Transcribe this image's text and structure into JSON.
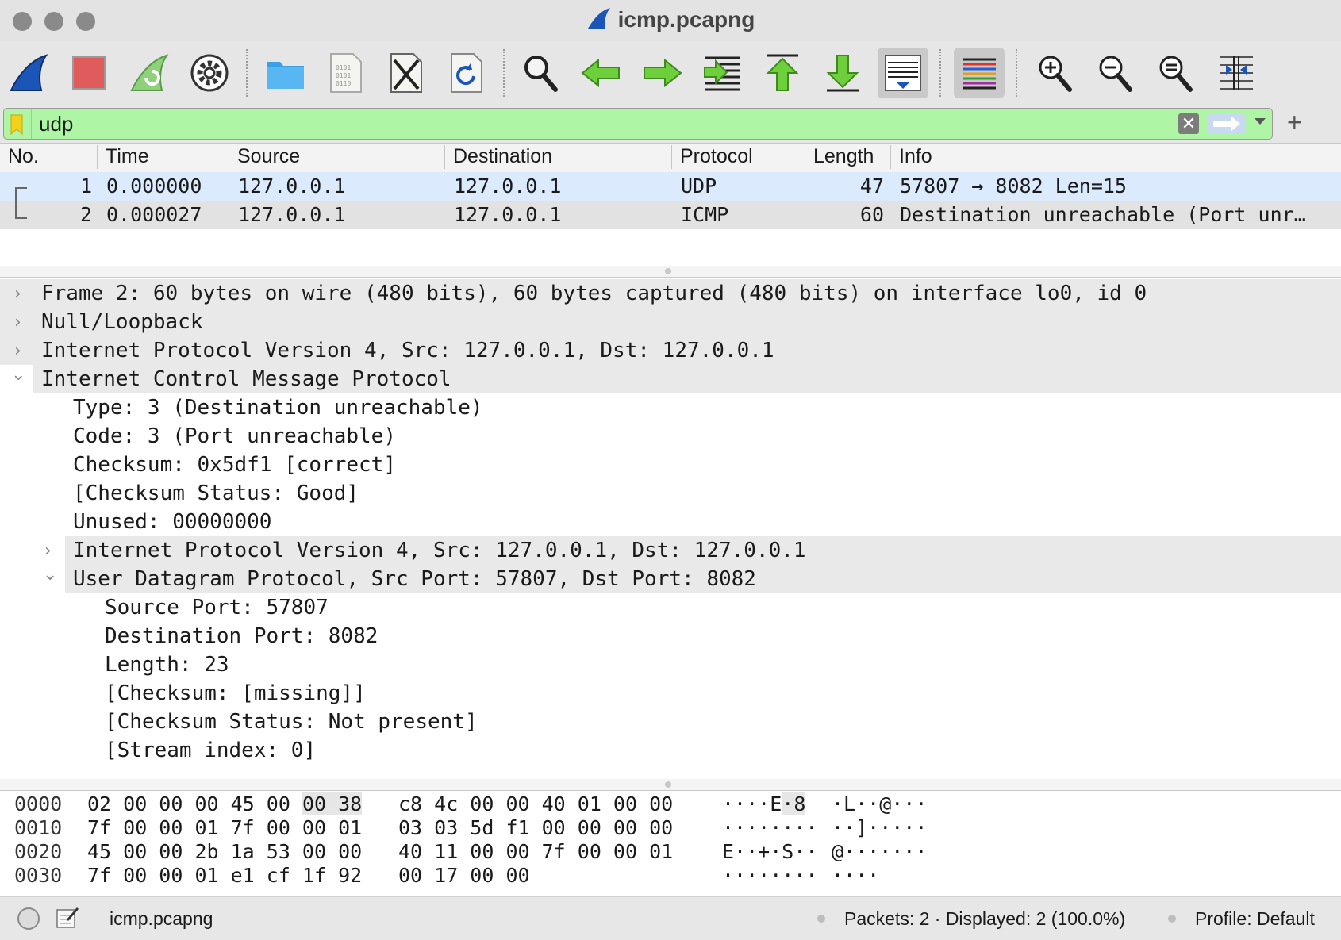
{
  "window": {
    "title": "icmp.pcapng"
  },
  "toolbar": {
    "buttons": [
      {
        "name": "start-capture-icon"
      },
      {
        "name": "stop-capture-icon"
      },
      {
        "name": "restart-capture-icon"
      },
      {
        "name": "capture-options-icon"
      },
      {
        "name": "open-file-icon"
      },
      {
        "name": "save-file-icon"
      },
      {
        "name": "close-file-icon"
      },
      {
        "name": "reload-file-icon"
      },
      {
        "name": "find-packet-icon"
      },
      {
        "name": "go-back-icon"
      },
      {
        "name": "go-forward-icon"
      },
      {
        "name": "go-to-packet-icon"
      },
      {
        "name": "go-first-packet-icon"
      },
      {
        "name": "go-last-packet-icon"
      },
      {
        "name": "autoscroll-icon"
      },
      {
        "name": "colorize-icon"
      },
      {
        "name": "zoom-in-icon"
      },
      {
        "name": "zoom-out-icon"
      },
      {
        "name": "zoom-normal-icon"
      },
      {
        "name": "resize-columns-icon"
      }
    ]
  },
  "filter": {
    "value": "udp",
    "clear_symbol": "✕",
    "plus_symbol": "+"
  },
  "packet_list": {
    "columns": [
      "No.",
      "Time",
      "Source",
      "Destination",
      "Protocol",
      "Length",
      "Info"
    ],
    "rows": [
      {
        "no": "1",
        "time": "0.000000",
        "source": "127.0.0.1",
        "destination": "127.0.0.1",
        "protocol": "UDP",
        "length": "47",
        "info": "57807 → 8082 Len=15"
      },
      {
        "no": "2",
        "time": "0.000027",
        "source": "127.0.0.1",
        "destination": "127.0.0.1",
        "protocol": "ICMP",
        "length": "60",
        "info": "Destination unreachable (Port unr…"
      }
    ]
  },
  "details": {
    "chevron_collapsed": "›",
    "chevron_expanded": "⌄",
    "rows": [
      {
        "text": "Frame 2: 60 bytes on wire (480 bits), 60 bytes captured (480 bits) on interface lo0, id 0",
        "expandable": "collapsed"
      },
      {
        "text": "Null/Loopback",
        "expandable": "collapsed"
      },
      {
        "text": "Internet Protocol Version 4, Src: 127.0.0.1, Dst: 127.0.0.1",
        "expandable": "collapsed"
      },
      {
        "text": "Internet Control Message Protocol",
        "expandable": "expanded"
      },
      {
        "text": "Type: 3 (Destination unreachable)",
        "expandable": "none"
      },
      {
        "text": "Code: 3 (Port unreachable)",
        "expandable": "none"
      },
      {
        "text": "Checksum: 0x5df1 [correct]",
        "expandable": "none"
      },
      {
        "text": "[Checksum Status: Good]",
        "expandable": "none"
      },
      {
        "text": "Unused: 00000000",
        "expandable": "none"
      },
      {
        "text": "Internet Protocol Version 4, Src: 127.0.0.1, Dst: 127.0.0.1",
        "expandable": "collapsed"
      },
      {
        "text": "User Datagram Protocol, Src Port: 57807, Dst Port: 8082",
        "expandable": "expanded"
      },
      {
        "text": "Source Port: 57807",
        "expandable": "none"
      },
      {
        "text": "Destination Port: 8082",
        "expandable": "none"
      },
      {
        "text": "Length: 23",
        "expandable": "none"
      },
      {
        "text": "[Checksum: [missing]]",
        "expandable": "none"
      },
      {
        "text": "[Checksum Status: Not present]",
        "expandable": "none"
      },
      {
        "text": "[Stream index: 0]",
        "expandable": "none"
      }
    ]
  },
  "bytes": {
    "rows": [
      {
        "offset": "0000",
        "hex1": "02 00 00 00 45 00",
        "hex1_hl": "00 38",
        "hex2": "c8 4c 00 00 40 01 00 00",
        "ascii1": "····E",
        "ascii1_hl": "·8",
        "ascii2": "·L··@···"
      },
      {
        "offset": "0010",
        "hex1": "7f 00 00 01 7f 00 00 01",
        "hex1_hl": "",
        "hex2": "03 03 5d f1 00 00 00 00",
        "ascii1": "········",
        "ascii1_hl": "",
        "ascii2": "··]·····"
      },
      {
        "offset": "0020",
        "hex1": "45 00 00 2b 1a 53 00 00",
        "hex1_hl": "",
        "hex2": "40 11 00 00 7f 00 00 01",
        "ascii1": "E··+·S··",
        "ascii1_hl": "",
        "ascii2": "@·······"
      },
      {
        "offset": "0030",
        "hex1": "7f 00 00 01 e1 cf 1f 92",
        "hex1_hl": "",
        "hex2": "00 17 00 00",
        "ascii1": "········",
        "ascii1_hl": "",
        "ascii2": "····"
      }
    ]
  },
  "status": {
    "file": "icmp.pcapng",
    "packets": "Packets: 2 · Displayed: 2 (100.0%)",
    "profile": "Profile: Default"
  },
  "colors": {
    "filter_valid": "#aef5a6",
    "selected_row": "#dbeafc",
    "related_row": "#e2e2e2",
    "green_arrow": "#5cb531",
    "shark_blue": "#1c55b8"
  }
}
